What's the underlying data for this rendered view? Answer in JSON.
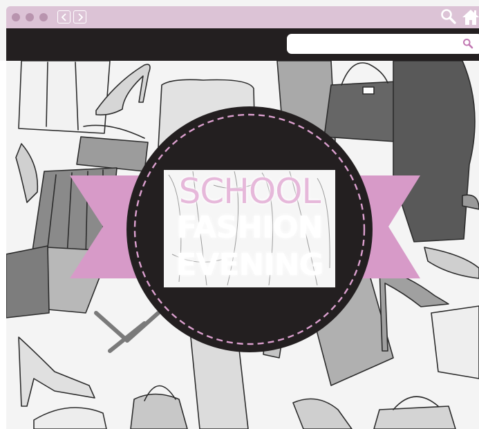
{
  "browser": {
    "window_controls": [
      "close-dot",
      "minimize-dot",
      "maximize-dot"
    ],
    "nav": {
      "back_icon": "chevron-left-icon",
      "forward_icon": "chevron-right-icon"
    },
    "toolbar_icons": [
      "search-icon",
      "home-icon"
    ],
    "search": {
      "value": "",
      "placeholder": "",
      "icon": "search-icon"
    }
  },
  "banner": {
    "line1": "SCHOOL",
    "line2": "FASHION",
    "line3": "EVENING"
  },
  "colors": {
    "titlebar": "#dcc3d6",
    "dots": "#b894ae",
    "dark": "#231f20",
    "ribbon": "#d79ac8",
    "dashed_ring": "#dca0cf",
    "school_text": "#e6b8da"
  }
}
